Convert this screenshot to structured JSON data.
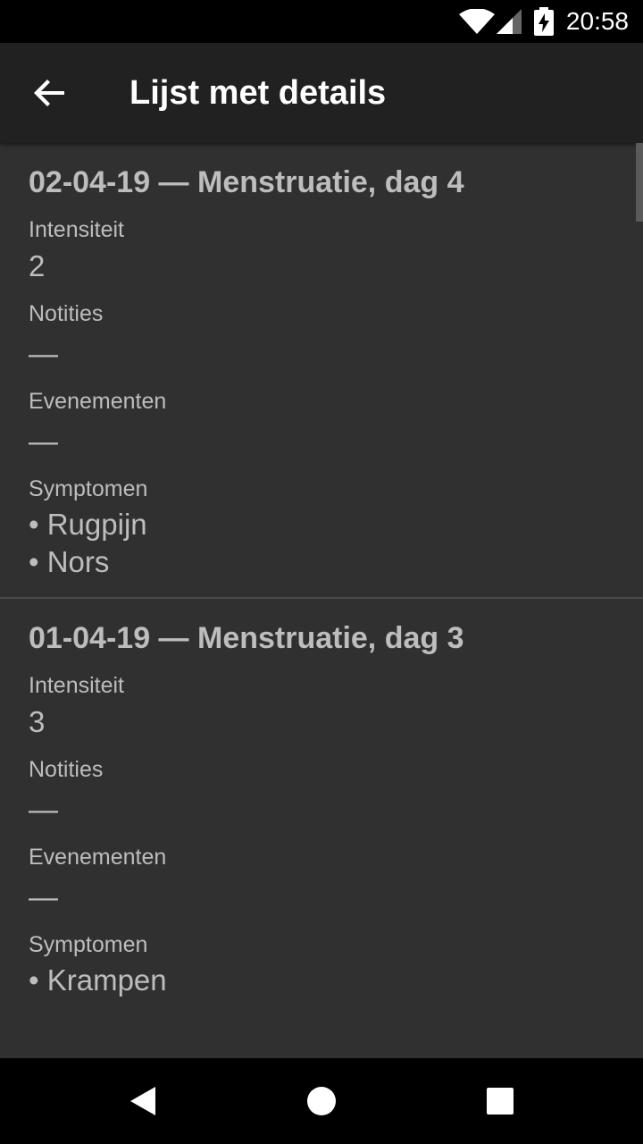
{
  "status_bar": {
    "time": "20:58"
  },
  "app_bar": {
    "title": "Lijst met details"
  },
  "entries": [
    {
      "title": "02-04-19 — Menstruatie, dag 4",
      "intensity_label": "Intensiteit",
      "intensity_value": "2",
      "notes_label": "Notities",
      "notes_value": "—",
      "events_label": "Evenementen",
      "events_value": "—",
      "symptoms_label": "Symptomen",
      "symptoms": [
        "• Rugpijn",
        "• Nors"
      ]
    },
    {
      "title": "01-04-19 — Menstruatie, dag 3",
      "intensity_label": "Intensiteit",
      "intensity_value": "3",
      "notes_label": "Notities",
      "notes_value": "—",
      "events_label": "Evenementen",
      "events_value": "—",
      "symptoms_label": "Symptomen",
      "symptoms": [
        "• Krampen"
      ]
    }
  ],
  "nav_bar": {
    "back_icon": "triangle-back-icon",
    "home_icon": "circle-home-icon",
    "recents_icon": "square-recents-icon"
  }
}
